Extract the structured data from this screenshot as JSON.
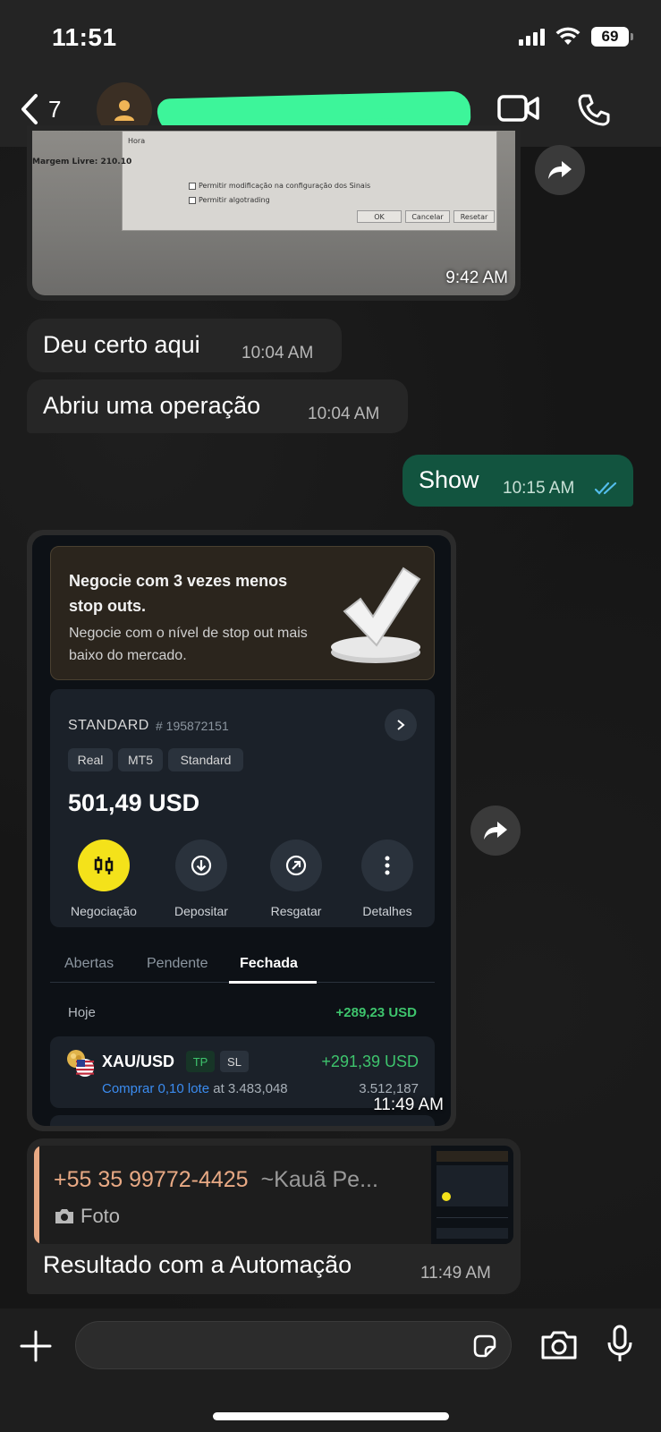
{
  "status_bar": {
    "time": "11:51",
    "battery": "69"
  },
  "header": {
    "back_count": "7"
  },
  "messages": {
    "image1": {
      "dialog_lines": [
        "Permitir modificação na configuração dos Sinais",
        "Permitir algotrading"
      ],
      "dialog_left_text": "Margem Livre: 210.10",
      "dialog_small": "Hora",
      "dialog_buttons": [
        "OK",
        "Cancelar",
        "Resetar"
      ],
      "time": "9:42 AM"
    },
    "m1": {
      "text": "Deu certo aqui",
      "time": "10:04 AM"
    },
    "m2": {
      "text": "Abriu uma operação",
      "time": "10:04 AM"
    },
    "m3": {
      "text": "Show",
      "time": "10:15 AM",
      "status": "read"
    },
    "image2": {
      "promo_title": "Negocie com 3 vezes menos stop outs.",
      "promo_sub": "Negocie com o nível de stop out mais baixo do mercado.",
      "account_type": "STANDARD",
      "account_number": "# 195872151",
      "tags": [
        "Real",
        "MT5",
        "Standard"
      ],
      "balance": "501,49 USD",
      "actions": [
        "Negociação",
        "Depositar",
        "Resgatar",
        "Detalhes"
      ],
      "tabs": [
        "Abertas",
        "Pendente",
        "Fechada"
      ],
      "active_tab": "Fechada",
      "day_label": "Hoje",
      "day_total": "+289,23 USD",
      "trade": {
        "pair": "XAU/USD",
        "tp": "TP",
        "sl": "SL",
        "profit": "+291,39 USD",
        "side": "Comprar 0,10 lote",
        "at": "at 3.483,048",
        "close": "3.512,187"
      },
      "time": "11:49 AM"
    },
    "reply": {
      "quoted_phone": "+55 35 99772-4425",
      "quoted_alias": "~Kauã Pe...",
      "quoted_type": "Foto",
      "text": "Resultado com a Automação",
      "time": "11:49 AM"
    }
  },
  "colors": {
    "accent_green": "#3df59a",
    "outgoing_bubble": "#12543f",
    "incoming_bubble": "#262626",
    "quote_name": "#e8a984"
  }
}
